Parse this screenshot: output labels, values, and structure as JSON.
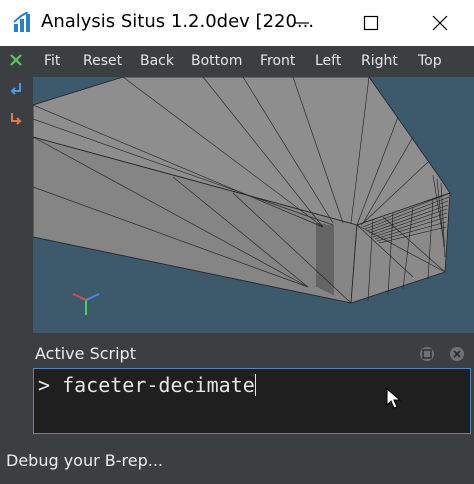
{
  "window": {
    "title": "Analysis Situs 1.2.0dev [220..."
  },
  "left_toolbar": {
    "icons": [
      "close-x-icon",
      "undo-arrow-icon",
      "redo-arrow-icon"
    ]
  },
  "view_toolbar": {
    "buttons": [
      "Fit",
      "Reset",
      "Back",
      "Bottom",
      "Front",
      "Left",
      "Right",
      "Top"
    ]
  },
  "viewport": {
    "background_color": "#3c5a6b",
    "model_color": "#8c8c8c"
  },
  "script_panel": {
    "title": "Active Script",
    "prompt": ">",
    "command": "faceter-decimate"
  },
  "status_bar": {
    "text": "Debug your B-rep..."
  },
  "colors": {
    "accent": "#4a88c7",
    "chrome": "#3c3f41",
    "console_bg": "#1f1f1f"
  }
}
